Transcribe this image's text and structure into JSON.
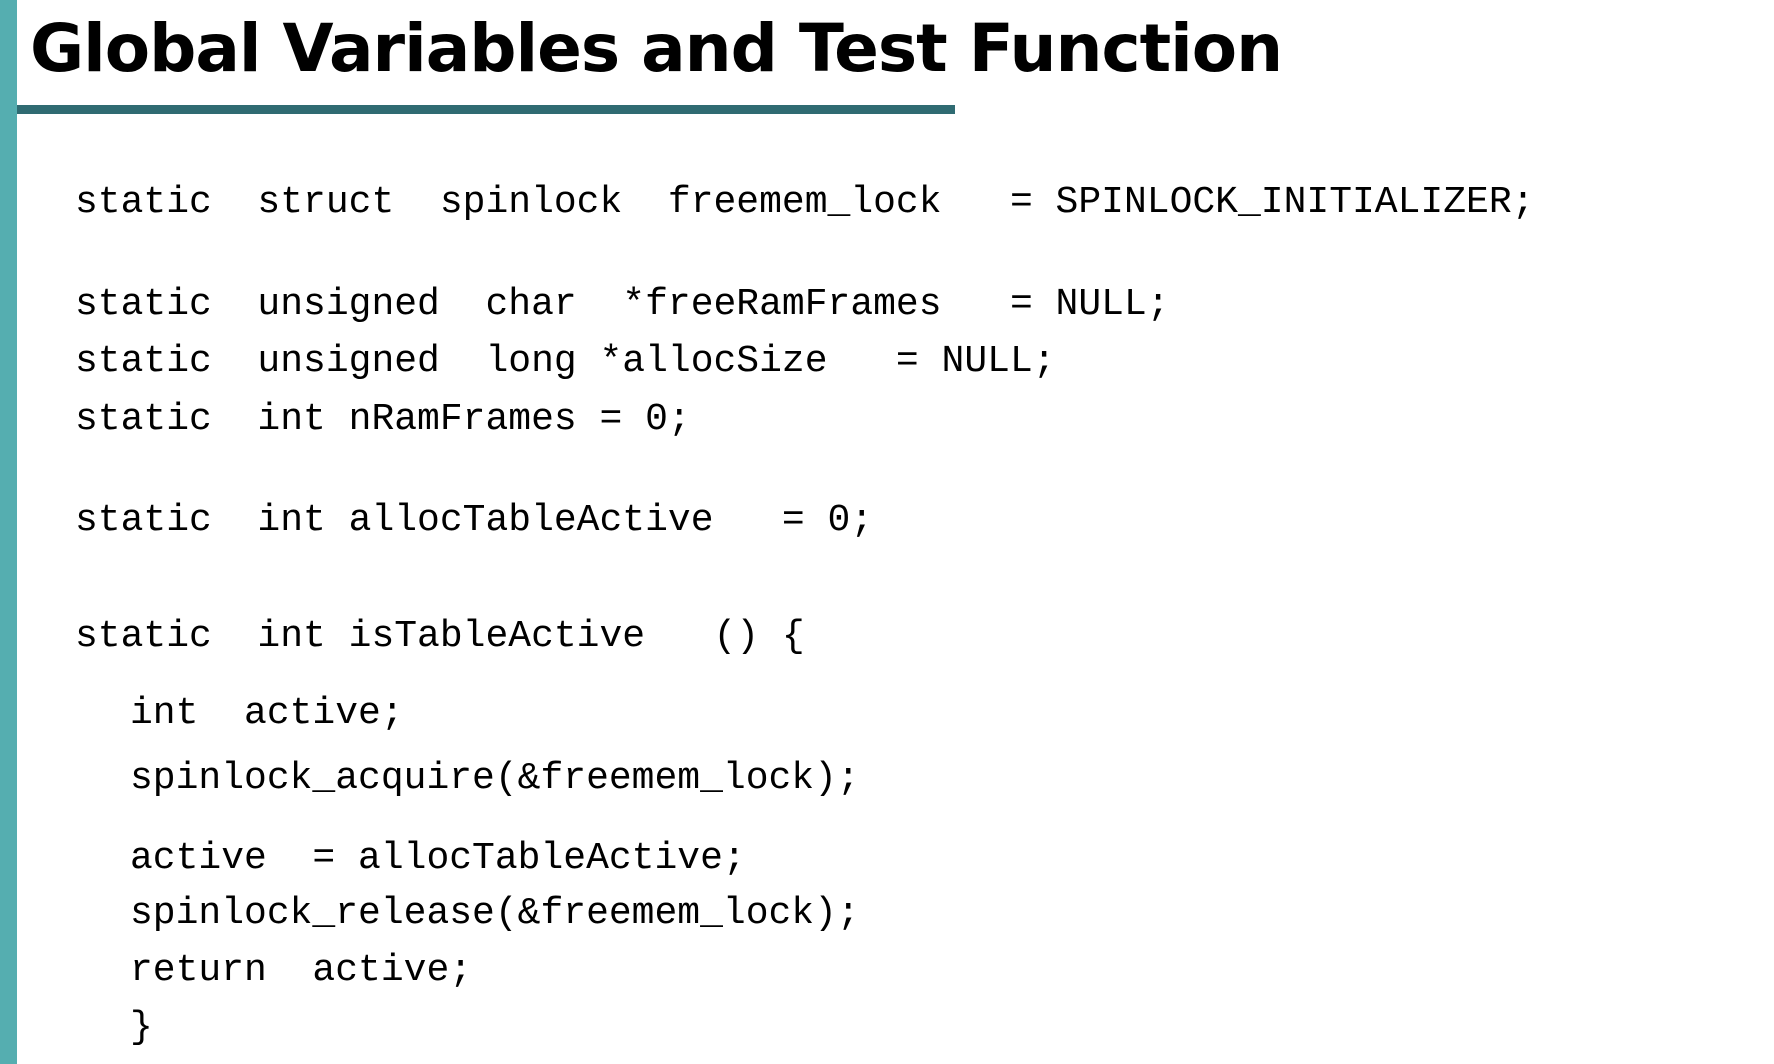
{
  "slide": {
    "title": "Global Variables and Test Function",
    "colors": {
      "left_bar": "#55aeb0",
      "title_rule": "#2f6b72",
      "text": "#000000",
      "background": "#ffffff"
    }
  },
  "code": {
    "lines": [
      "static  struct  spinlock  freemem_lock   = SPINLOCK_INITIALIZER;",
      "static  unsigned  char  *freeRamFrames   = NULL;",
      "static  unsigned  long *allocSize   = NULL;",
      "static  int nRamFrames = 0;",
      "static  int allocTableActive   = 0;",
      "static  int isTableActive   () {",
      "int  active;",
      "spinlock_acquire(&freemem_lock);",
      "active  = allocTableActive;",
      "spinlock_release(&freemem_lock);",
      "return  active;",
      "}"
    ]
  }
}
